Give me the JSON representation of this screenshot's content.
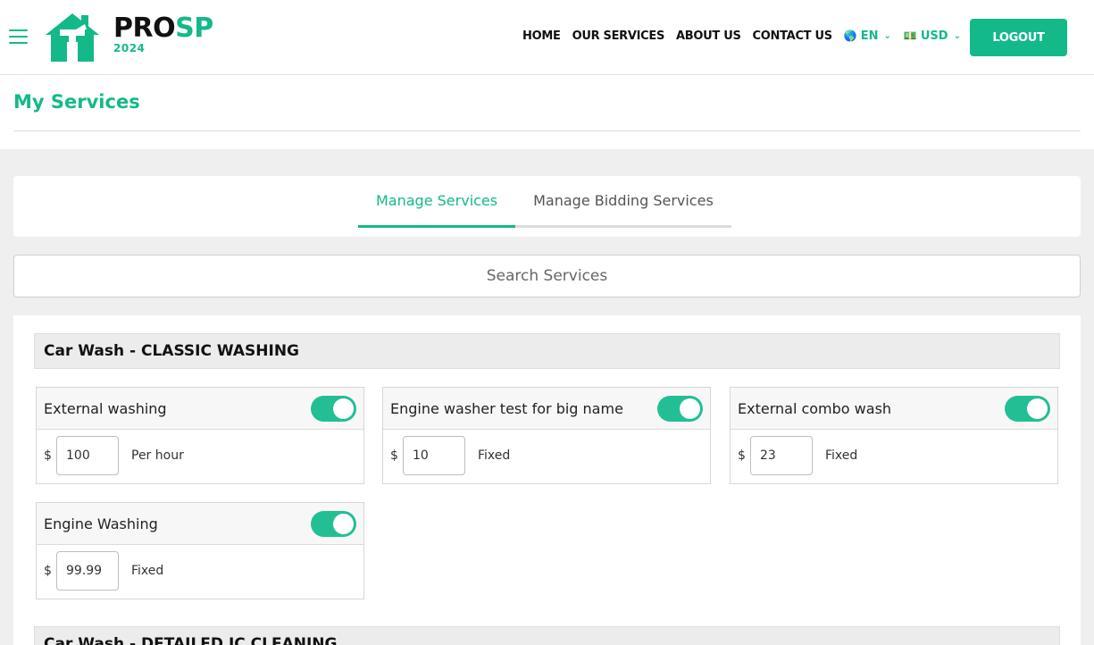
{
  "header": {
    "logo": {
      "pro": "PRO",
      "sp": "SP",
      "year": "2024"
    },
    "nav": [
      {
        "label": "HOME"
      },
      {
        "label": "OUR SERVICES"
      },
      {
        "label": "ABOUT US"
      },
      {
        "label": "CONTACT US"
      }
    ],
    "language": {
      "flag": "🌎",
      "label": "EN"
    },
    "currency": {
      "flag": "💵",
      "label": "USD"
    },
    "logout_label": "LOGOUT"
  },
  "page": {
    "title": "My Services"
  },
  "tabs": [
    {
      "label": "Manage Services",
      "active": true
    },
    {
      "label": "Manage Bidding Services",
      "active": false
    }
  ],
  "search": {
    "placeholder": "Search Services",
    "value": ""
  },
  "categories": [
    {
      "title": "Car Wash - CLASSIC WASHING",
      "services": [
        {
          "name": "External washing",
          "enabled": true,
          "currency": "$",
          "price": "100",
          "unit": "Per hour"
        },
        {
          "name": "Engine washer test for big name",
          "enabled": true,
          "currency": "$",
          "price": "10",
          "unit": "Fixed"
        },
        {
          "name": "External combo wash",
          "enabled": true,
          "currency": "$",
          "price": "23",
          "unit": "Fixed"
        },
        {
          "name": "Engine Washing",
          "enabled": true,
          "currency": "$",
          "price": "99.99",
          "unit": "Fixed"
        }
      ]
    },
    {
      "title": "Car Wash - DETAILED IC CLEANING"
    }
  ],
  "colors": {
    "accent": "#14b98a",
    "toggle_on": "#22bf95"
  },
  "icons": {
    "menu": "hamburger-menu-icon",
    "logo": "house-hammer-logo-icon",
    "dropdown": "chevron-down-icon"
  }
}
